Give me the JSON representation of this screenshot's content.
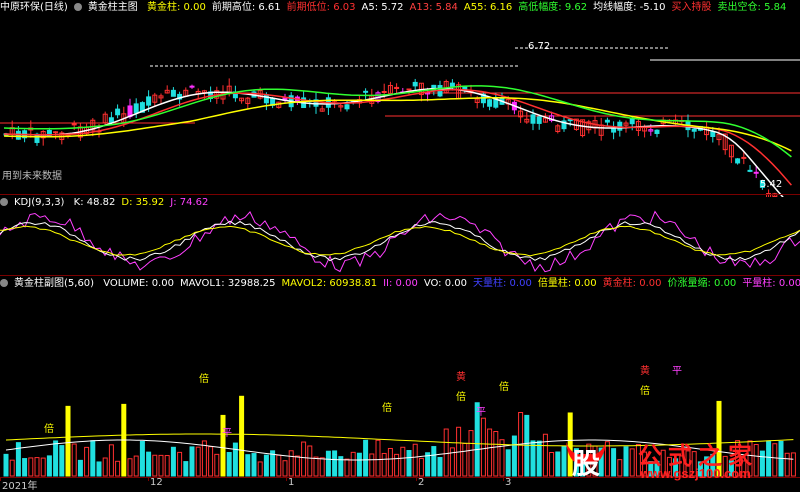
{
  "header": {
    "stock": "中原环保(日线)",
    "indicator": "黄金柱主图",
    "items": [
      {
        "label": "黄金柱:",
        "value": "0.00",
        "color": "#ffff00"
      },
      {
        "label": "前期高位:",
        "value": "6.61",
        "color": "#ffffff"
      },
      {
        "label": "前期低位:",
        "value": "6.03",
        "color": "#ff3030"
      },
      {
        "label": "A5:",
        "value": "5.72",
        "color": "#ffffff"
      },
      {
        "label": "A13:",
        "value": "5.84",
        "color": "#ff4040"
      },
      {
        "label": "A55:",
        "value": "6.16",
        "color": "#ffff00"
      },
      {
        "label": "高低幅度:",
        "value": "9.62",
        "color": "#30ff30"
      },
      {
        "label": "均线幅度:",
        "value": "-5.10",
        "color": "#ffffff"
      },
      {
        "label": "买入持股",
        "value": "",
        "color": "#ff3030"
      },
      {
        "label": "卖出空仓:",
        "value": "5.84",
        "color": "#30ff30"
      }
    ],
    "price_high_label": "6.72",
    "price_low_label": "5.42",
    "no_future_text": "用到未来数据"
  },
  "kdj": {
    "title": "KDJ(9,3,3)",
    "items": [
      {
        "label": "K:",
        "value": "48.82",
        "color": "#ffffff"
      },
      {
        "label": "D:",
        "value": "35.92",
        "color": "#ffff00"
      },
      {
        "label": "J:",
        "value": "74.62",
        "color": "#ff40ff"
      }
    ]
  },
  "volume": {
    "title": "黄金柱副图(5,60)",
    "items": [
      {
        "label": "VOLUME:",
        "value": "0.00",
        "color": "#ffffff"
      },
      {
        "label": "MAVOL1:",
        "value": "32988.25",
        "color": "#ffffff"
      },
      {
        "label": "MAVOL2:",
        "value": "60938.81",
        "color": "#ffff00"
      },
      {
        "label": "II:",
        "value": "0.00",
        "color": "#ff40ff"
      },
      {
        "label": "VO:",
        "value": "0.00",
        "color": "#ffffff"
      },
      {
        "label": "天量柱:",
        "value": "0.00",
        "color": "#4040ff"
      },
      {
        "label": "倍量柱:",
        "value": "0.00",
        "color": "#ffff00"
      },
      {
        "label": "黄金柱:",
        "value": "0.00",
        "color": "#ff3030"
      },
      {
        "label": "价涨量缩:",
        "value": "0.00",
        "color": "#30ff30"
      },
      {
        "label": "平量柱:",
        "value": "0.00",
        "color": "#ff40ff"
      }
    ],
    "markers": [
      {
        "text": "倍",
        "color": "#ffff00"
      },
      {
        "text": "倍",
        "color": "#ffff00"
      },
      {
        "text": "倍",
        "color": "#ffff00"
      },
      {
        "text": "倍",
        "color": "#ffff00"
      },
      {
        "text": "黄",
        "color": "#ff3030"
      },
      {
        "text": "平",
        "color": "#ff40ff"
      },
      {
        "text": "倍",
        "color": "#ffff00"
      },
      {
        "text": "黄",
        "color": "#ff3030"
      },
      {
        "text": "平",
        "color": "#ff40ff"
      },
      {
        "text": "倍",
        "color": "#ffff00"
      },
      {
        "text": "平",
        "color": "#ff40ff"
      }
    ]
  },
  "time_axis": {
    "labels": [
      "2021年",
      "12",
      "1",
      "2",
      "3"
    ]
  },
  "watermark": {
    "glyph": "股",
    "brand": "公式之家",
    "url": "www.gszj100.com"
  },
  "colors": {
    "up": "#ff3030",
    "down": "#20e0e0",
    "special": "#ff30ff",
    "grid": "#7a0000"
  }
}
